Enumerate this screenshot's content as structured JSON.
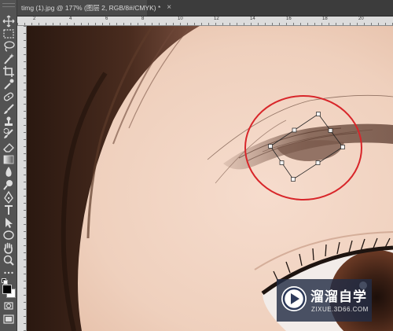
{
  "document_tab": {
    "title": "timg (1).jpg @ 177% (图层 2, RGB/8#/CMYK) *",
    "close_symbol": "×"
  },
  "tools": [
    {
      "name": "move-tool-icon"
    },
    {
      "name": "marquee-tool-icon"
    },
    {
      "name": "lasso-tool-icon"
    },
    {
      "name": "magic-wand-tool-icon"
    },
    {
      "name": "crop-tool-icon"
    },
    {
      "name": "eyedropper-tool-icon"
    },
    {
      "name": "healing-brush-tool-icon"
    },
    {
      "name": "brush-tool-icon"
    },
    {
      "name": "clone-stamp-tool-icon"
    },
    {
      "name": "history-brush-tool-icon"
    },
    {
      "name": "eraser-tool-icon"
    },
    {
      "name": "gradient-tool-icon"
    },
    {
      "name": "blur-tool-icon"
    },
    {
      "name": "dodge-tool-icon"
    },
    {
      "name": "pen-tool-icon"
    },
    {
      "name": "type-tool-icon"
    },
    {
      "name": "path-selection-tool-icon"
    },
    {
      "name": "shape-tool-icon"
    },
    {
      "name": "hand-tool-icon"
    },
    {
      "name": "zoom-tool-icon"
    },
    {
      "name": "more-tools-icon"
    },
    {
      "name": "default-colors-icon"
    },
    {
      "name": "color-swatches-icon"
    },
    {
      "name": "quick-mask-icon"
    },
    {
      "name": "screen-mode-icon"
    }
  ],
  "colors": {
    "foreground": "#000000",
    "background": "#ffffff",
    "annotation_circle": "#d8262a",
    "panel_bg": "#535353",
    "tab_bg": "#4a4a4a"
  },
  "ruler_labels": [
    "2",
    "4",
    "6",
    "8",
    "10",
    "12",
    "14",
    "16",
    "18",
    "20"
  ],
  "watermark": {
    "title": "溜溜自学",
    "url": "ZIXUE.3D66.COM"
  }
}
